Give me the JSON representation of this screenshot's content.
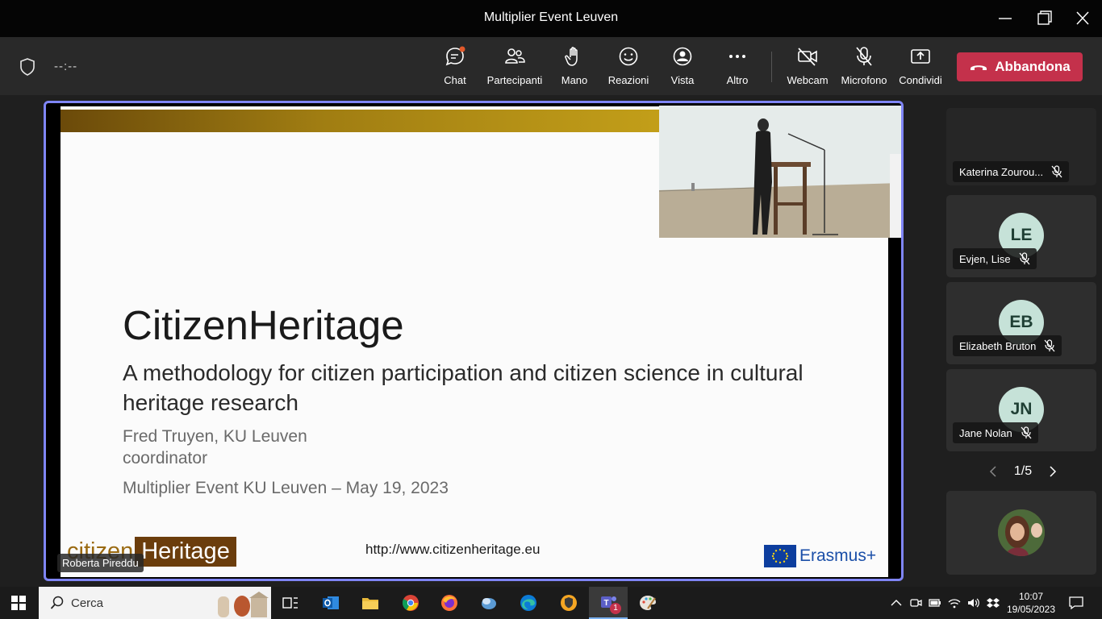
{
  "window": {
    "title": "Multiplier Event Leuven"
  },
  "toolbar": {
    "timer": "--:--",
    "buttons": [
      {
        "id": "chat",
        "label": "Chat",
        "icon": "chat-icon"
      },
      {
        "id": "participants",
        "label": "Partecipanti",
        "icon": "people-icon"
      },
      {
        "id": "hand",
        "label": "Mano",
        "icon": "raise-hand-icon"
      },
      {
        "id": "reactions",
        "label": "Reazioni",
        "icon": "smiley-icon"
      },
      {
        "id": "view",
        "label": "Vista",
        "icon": "view-icon"
      },
      {
        "id": "more",
        "label": "Altro",
        "icon": "more-icon"
      },
      {
        "id": "webcam",
        "label": "Webcam",
        "icon": "camera-off-icon"
      },
      {
        "id": "mic",
        "label": "Microfono",
        "icon": "mic-off-icon"
      },
      {
        "id": "share",
        "label": "Condividi",
        "icon": "share-icon"
      }
    ],
    "leave_label": "Abbandona",
    "accent": "#c4314b"
  },
  "stage": {
    "presenter_name": "Roberta Pireddu",
    "slide": {
      "title": "CitizenHeritage",
      "subtitle": "A methodology for citizen participation and citizen science in cultural heritage research",
      "author": "Fred Truyen, KU Leuven",
      "role": "coordinator",
      "event": "Multiplier Event KU Leuven – May 19, 2023",
      "url": "http://www.citizenheritage.eu",
      "logo_left": "citizen",
      "logo_right": "Heritage",
      "erasmus": "Erasmus+"
    }
  },
  "participants": {
    "items": [
      {
        "name": "Katerina Zourou...",
        "initials": "",
        "muted": true
      },
      {
        "name": "Evjen, Lise",
        "initials": "LE",
        "muted": true
      },
      {
        "name": "Elizabeth Bruton",
        "initials": "EB",
        "muted": true
      },
      {
        "name": "Jane Nolan",
        "initials": "JN",
        "muted": true
      }
    ],
    "pager": "1/5"
  },
  "taskbar": {
    "search_placeholder": "Cerca",
    "teams_badge": "1",
    "time": "10:07",
    "date": "19/05/2023"
  }
}
